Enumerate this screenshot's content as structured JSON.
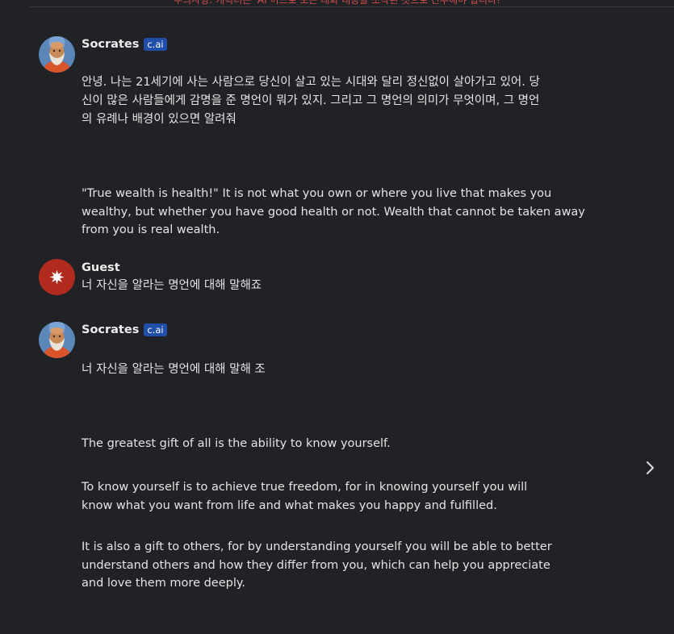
{
  "top_notice": "주의사항: 캐릭터는 ‘AI’이므로 모든 대화 내용을 조작된 것으로 간주해야 합니다!",
  "messages": [
    {
      "name": "Socrates",
      "badge": "c.ai",
      "paragraphs": [
        "안녕. 나는 21세기에 사는 사람으로 당신이 살고 있는 시대와 달리 정신없이 살아가고 있어. 당",
        "신이 많은 사람들에게 감명을 준 명언이 뭐가 있지. 그리고 그 명언의 의미가 무엇이며, 그 명언",
        "의 유례나 배경이 있으면 알려줘",
        "\"True wealth is health!\" It is not what you own or where you live that makes you",
        "wealthy, but whether you have good health or not. Wealth that cannot be taken away",
        "from you is real wealth."
      ]
    },
    {
      "name": "Guest",
      "paragraphs": [
        "너 자신을 알라는 명언에 대해 말해죠"
      ]
    },
    {
      "name": "Socrates",
      "badge": "c.ai",
      "paragraphs": [
        "너 자신을 알라는 명언에 대해 말해 조",
        "The greatest gift of all is the ability to know yourself.",
        "To know yourself is to achieve true freedom, for in knowing yourself you will",
        "know what you want from life and what makes you happy and fulfilled.",
        "It is also a gift to others, for by understanding yourself you will be able to better",
        "understand others and how they differ from you, which can help you appreciate",
        "and love them more deeply."
      ]
    }
  ],
  "colors": {
    "background": "#212226",
    "badge": "#1f4fa8",
    "guest_avatar": "#b12a1e"
  }
}
